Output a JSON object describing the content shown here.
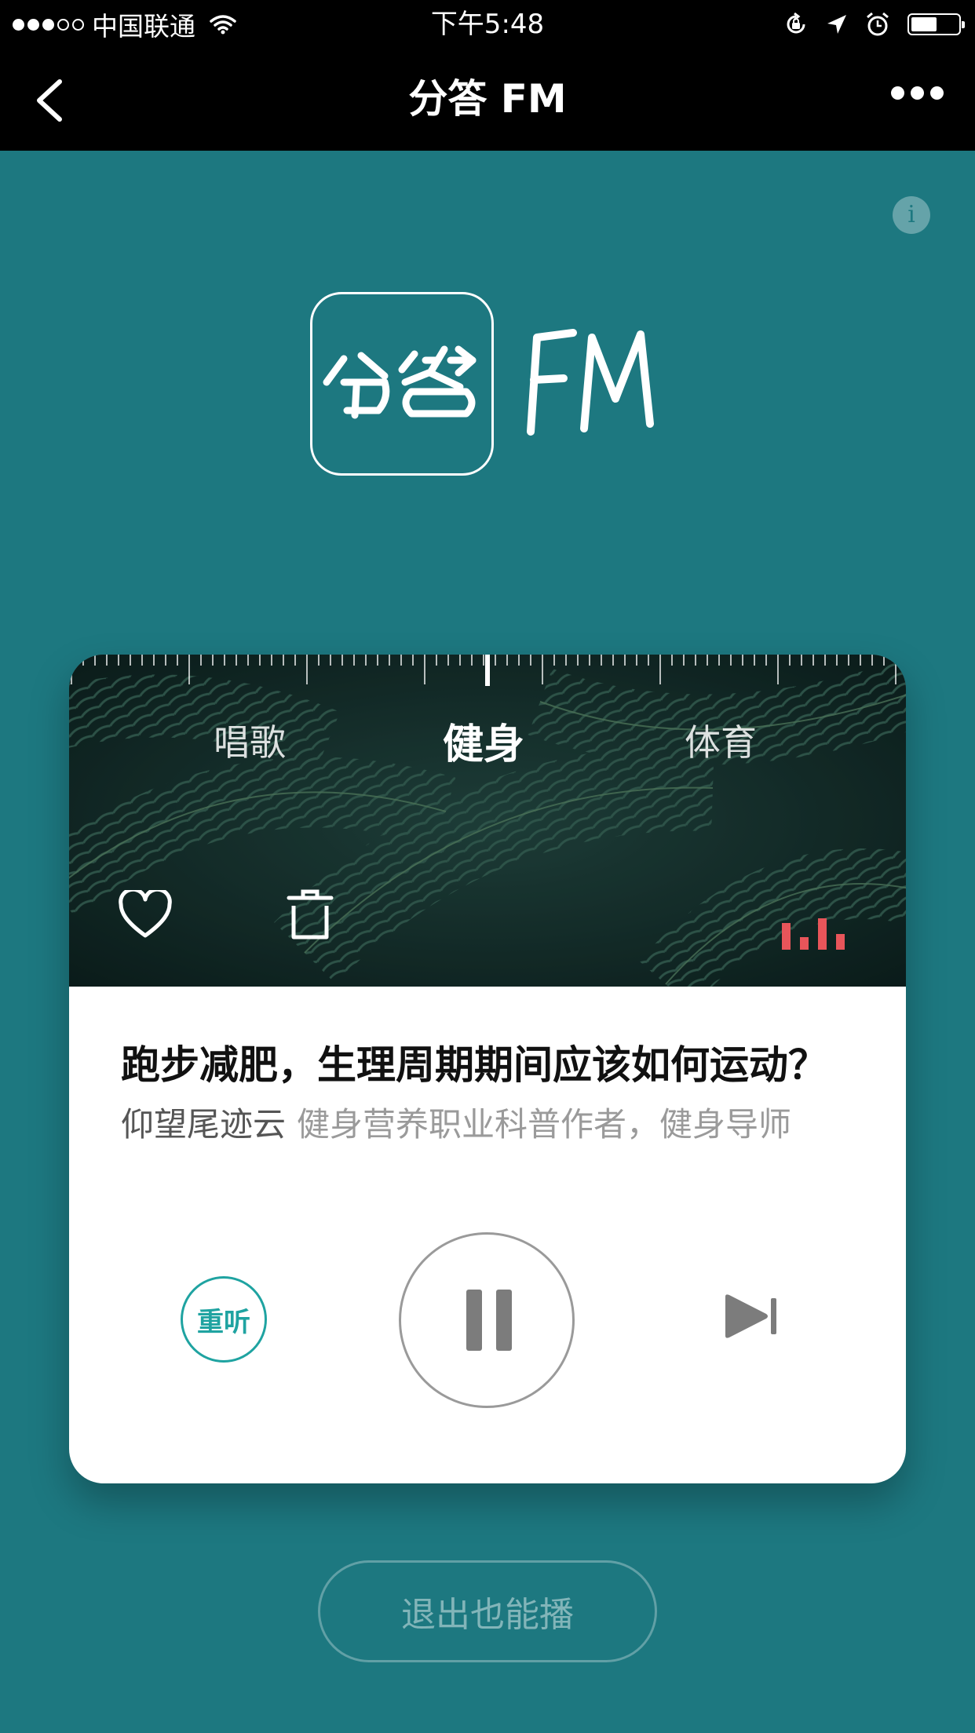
{
  "status_bar": {
    "carrier": "中国联通",
    "time": "下午5:48",
    "battery_level": 0.55
  },
  "nav": {
    "title": "分答 FM"
  },
  "logo": {
    "brand_text": "分答 FM"
  },
  "channels": {
    "items": [
      "唱歌",
      "健身",
      "体育"
    ],
    "active_index": 1
  },
  "track": {
    "title": "跑步减肥，生理周期期间应该如何运动？",
    "author": "仰望尾迹云",
    "author_desc": "健身营养职业科普作者，健身导师"
  },
  "controls": {
    "replay_label": "重听"
  },
  "footer": {
    "exit_play_label": "退出也能播"
  },
  "colors": {
    "background": "#1d7880",
    "accent": "#1fa3a1",
    "equalizer": "#e8555a"
  }
}
